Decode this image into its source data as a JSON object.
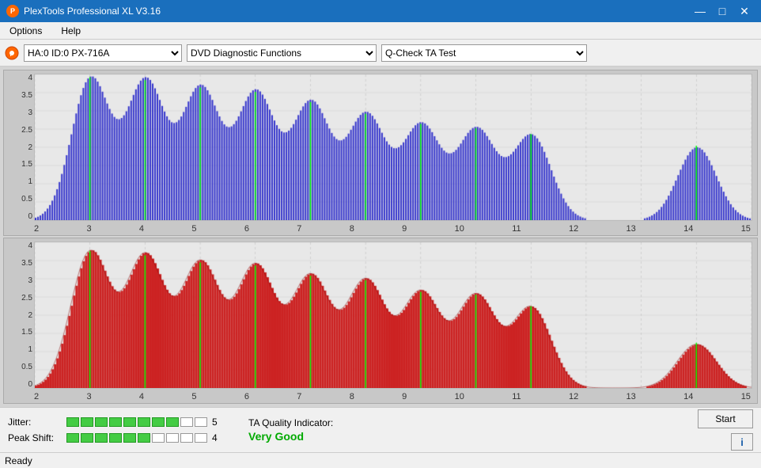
{
  "titleBar": {
    "title": "PlexTools Professional XL V3.16",
    "iconText": "P",
    "minimizeLabel": "—",
    "maximizeLabel": "□",
    "closeLabel": "✕"
  },
  "menuBar": {
    "items": [
      "Options",
      "Help"
    ]
  },
  "toolbar": {
    "deviceLabel": "HA:0 ID:0  PX-716A",
    "functionLabel": "DVD Diagnostic Functions",
    "testLabel": "Q-Check TA Test"
  },
  "charts": {
    "yLabels": [
      "4",
      "3.5",
      "3",
      "2.5",
      "2",
      "1.5",
      "1",
      "0.5",
      "0"
    ],
    "xLabels": [
      "2",
      "3",
      "4",
      "5",
      "6",
      "7",
      "8",
      "9",
      "10",
      "11",
      "12",
      "13",
      "14",
      "15"
    ]
  },
  "metrics": {
    "jitterLabel": "Jitter:",
    "jitterValue": "5",
    "jitterFilledCells": 8,
    "jitterTotalCells": 10,
    "peakShiftLabel": "Peak Shift:",
    "peakShiftValue": "4",
    "peakShiftFilledCells": 6,
    "peakShiftTotalCells": 10,
    "taQualityLabel": "TA Quality Indicator:",
    "taQualityValue": "Very Good",
    "startButton": "Start",
    "infoButton": "i"
  },
  "statusBar": {
    "status": "Ready"
  }
}
